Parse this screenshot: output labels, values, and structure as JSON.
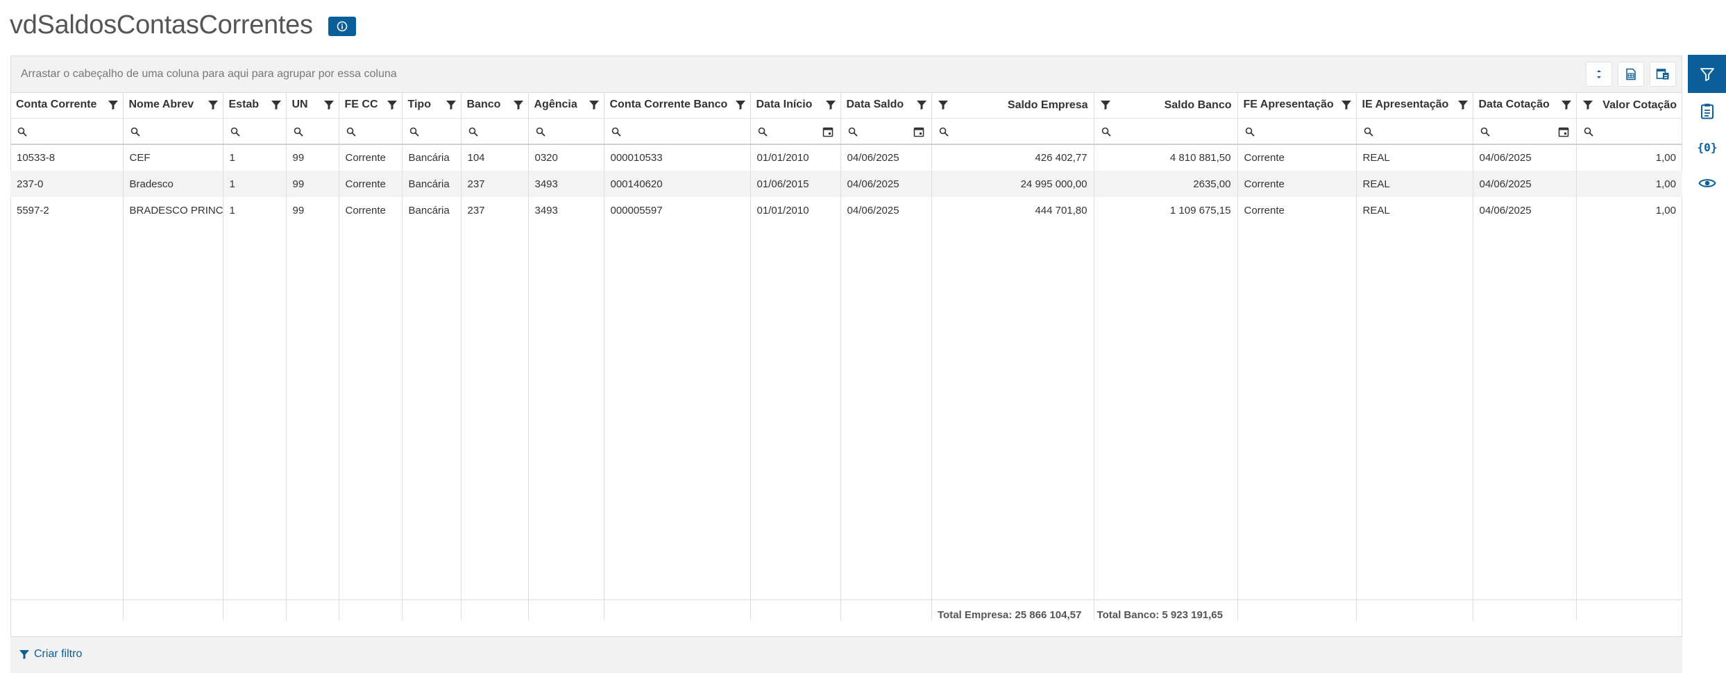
{
  "page": {
    "title": "vdSaldosContasCorrentes"
  },
  "grid": {
    "group_hint": "Arrastar o cabeçalho de uma coluna para aqui para agrupar por essa coluna",
    "columns": [
      "Conta Corrente",
      "Nome Abrev",
      "Estab",
      "UN",
      "FE CC",
      "Tipo",
      "Banco",
      "Agência",
      "Conta Corrente Banco",
      "Data Início",
      "Data Saldo",
      "Saldo Empresa",
      "Saldo Banco",
      "FE Apresentação",
      "IE Apresentação",
      "Data Cotação",
      "Valor Cotação"
    ],
    "rows": [
      [
        "10533-8",
        "CEF",
        "1",
        "99",
        "Corrente",
        "Bancária",
        "104",
        "0320",
        "000010533",
        "01/01/2010",
        "04/06/2025",
        "426 402,77",
        "4 810 881,50",
        "Corrente",
        "REAL",
        "04/06/2025",
        "1,00"
      ],
      [
        "237-0",
        "Bradesco",
        "1",
        "99",
        "Corrente",
        "Bancária",
        "237",
        "3493",
        "000140620",
        "01/06/2015",
        "04/06/2025",
        "24 995 000,00",
        "2635,00",
        "Corrente",
        "REAL",
        "04/06/2025",
        "1,00"
      ],
      [
        "5597-2",
        "BRADESCO PRINC",
        "1",
        "99",
        "Corrente",
        "Bancária",
        "237",
        "3493",
        "000005597",
        "01/01/2010",
        "04/06/2025",
        "444 701,80",
        "1 109 675,15",
        "Corrente",
        "REAL",
        "04/06/2025",
        "1,00"
      ]
    ],
    "totals": {
      "empresa": "Total Empresa: 25 866 104,57",
      "banco": "Total Banco: 5 923 191,65"
    },
    "create_filter": "Criar filtro"
  },
  "icons": {
    "info": "info-icon",
    "expand": "expand-collapse-icon",
    "excel": "excel-export-icon",
    "columns": "column-chooser-icon",
    "filter": "filter-icon",
    "clipboard": "clipboard-icon",
    "variables": "variables-icon",
    "eye": "eye-icon",
    "search": "search-icon",
    "calendar": "calendar-icon"
  },
  "colors": {
    "accent": "#0b5f99",
    "panel": "#f2f2f2",
    "alt_row": "#f3f3f3"
  }
}
